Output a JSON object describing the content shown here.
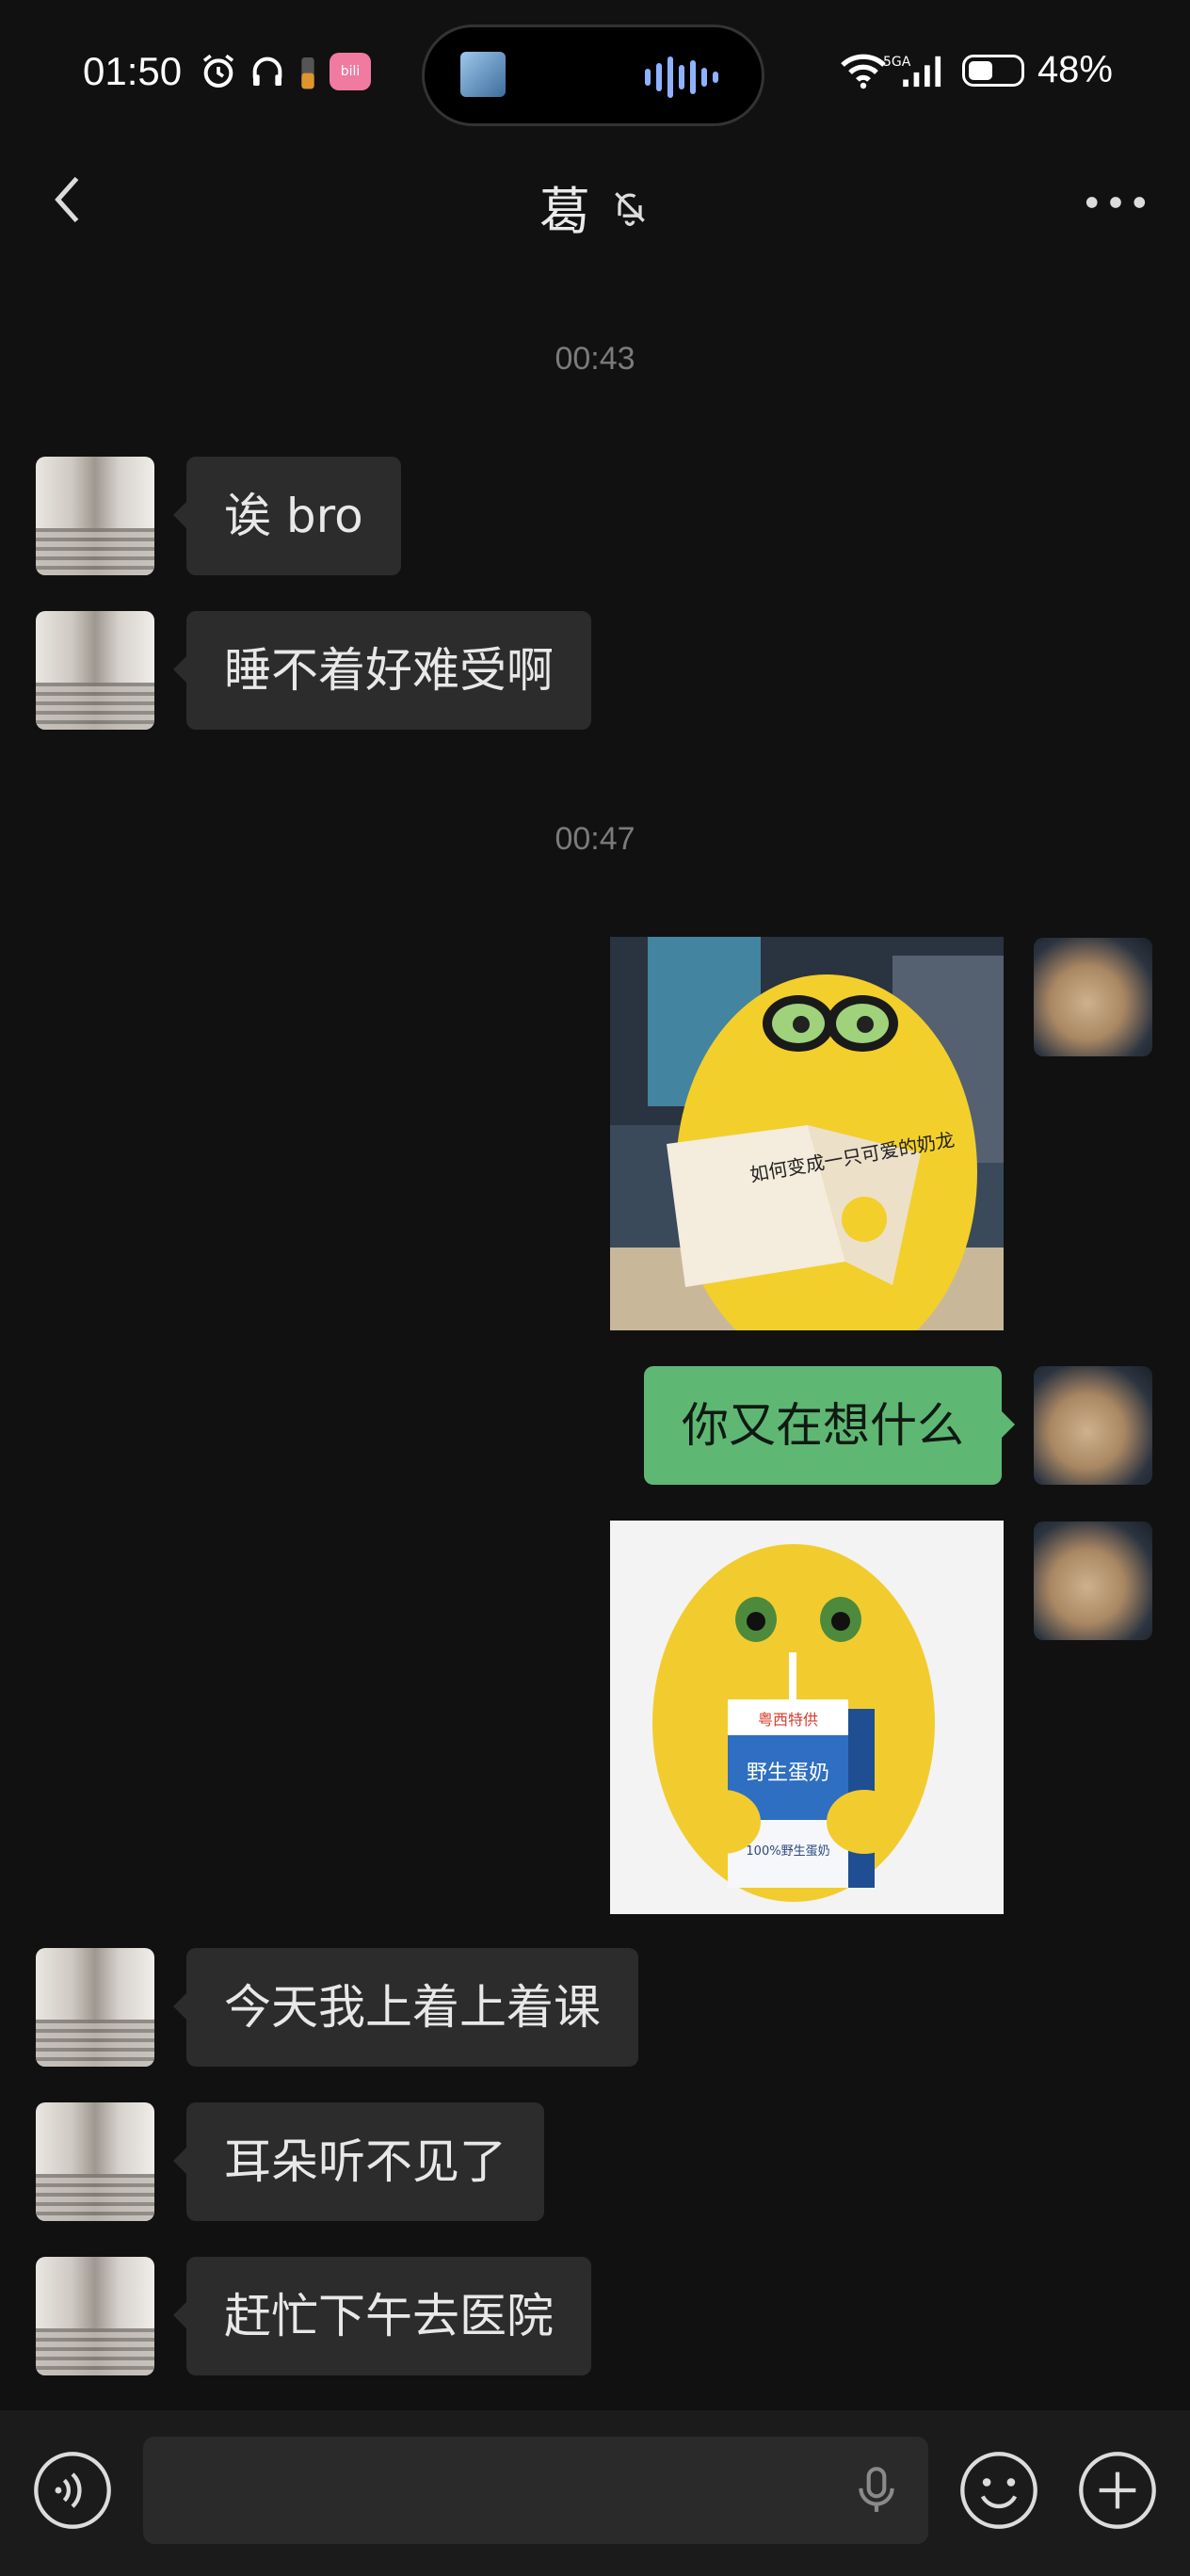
{
  "status_bar": {
    "time": "01:50",
    "network": "5GA",
    "battery_percent": "48%",
    "battery_level": 0.48,
    "app_badge": "bilibili"
  },
  "header": {
    "back_icon": "chevron-left-icon",
    "title": "葛",
    "mute_icon": "bell-off-icon",
    "more_icon": "more-horizontal-icon"
  },
  "messages": {
    "ts1": "00:43",
    "m1": "诶 bro",
    "m2": "睡不着好难受啊",
    "ts2": "00:47",
    "sticker1_text": "如何变成一只可爱的奶龙",
    "m3": "你又在想什么",
    "sticker2_brand": "粤西特供",
    "sticker2_title": "野生蛋奶",
    "sticker2_sub": "100%野生蛋奶",
    "m4": "今天我上着上着课",
    "m5": "耳朵听不见了",
    "m6": "赶忙下午去医院"
  },
  "input_bar": {
    "voice_icon": "voice-mode-icon",
    "mic_icon": "microphone-icon",
    "emoji_icon": "emoji-icon",
    "plus_icon": "plus-circle-icon"
  },
  "colors": {
    "background": "#111111",
    "bubble_them": "#2c2c2c",
    "bubble_me": "#5fb774",
    "timestamp": "#7b7b7b"
  }
}
